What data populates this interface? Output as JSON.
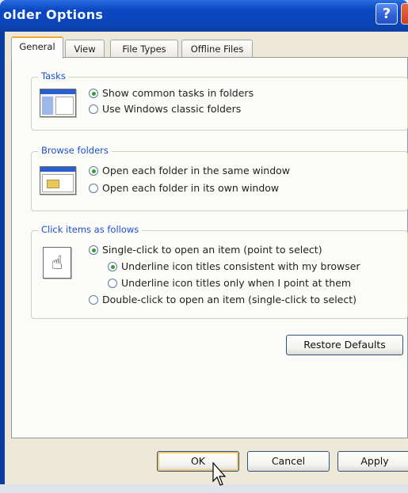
{
  "window": {
    "title": "older Options",
    "help_icon_glyph": "?"
  },
  "tabs": [
    {
      "label": "General",
      "active": true
    },
    {
      "label": "View",
      "active": false
    },
    {
      "label": "File Types",
      "active": false
    },
    {
      "label": "Offline Files",
      "active": false
    }
  ],
  "tasks": {
    "title": "Tasks",
    "options": [
      {
        "label": "Show common tasks in folders",
        "selected": true
      },
      {
        "label": "Use Windows classic folders",
        "selected": false
      }
    ]
  },
  "browse": {
    "title": "Browse folders",
    "options": [
      {
        "label": "Open each folder in the same window",
        "selected": true
      },
      {
        "label": "Open each folder in its own window",
        "selected": false
      }
    ]
  },
  "click": {
    "title": "Click items as follows",
    "options": [
      {
        "label": "Single-click to open an item (point to select)",
        "selected": true
      },
      {
        "label": "Underline icon titles consistent with my browser",
        "selected": true
      },
      {
        "label": "Underline icon titles only when I point at them",
        "selected": false
      },
      {
        "label": "Double-click to open an item (single-click to select)",
        "selected": false
      }
    ]
  },
  "buttons": {
    "restore_defaults": "Restore Defaults",
    "ok": "OK",
    "cancel": "Cancel",
    "apply": "Apply"
  },
  "colors": {
    "title_bar": "#0b49c3",
    "group_title": "#1c4fd0",
    "dialog_face": "#ece9d8"
  }
}
